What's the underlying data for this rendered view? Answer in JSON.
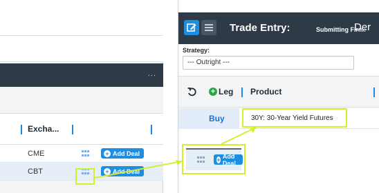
{
  "left_panel": {
    "column_header": "Excha...",
    "rows": [
      {
        "exchange": "CME",
        "add_deal_label": "Add Deal"
      },
      {
        "exchange": "CBT",
        "add_deal_label": "Add Deal"
      }
    ],
    "menu_dots": "..."
  },
  "trade_entry": {
    "title": "Trade Entry:",
    "submitting_firm_label": "Submitting Firm:",
    "submitting_firm_value": "Der",
    "strategy_label": "Strategy:",
    "strategy_value": "--- Outright ---",
    "leg_label": "Leg",
    "product_header": "Product",
    "row": {
      "side": "Buy",
      "product": "30Y: 30-Year Yield Futures"
    }
  },
  "callout": {
    "add_deal_label": "Add Deal",
    "highlight_color": "#d4ee32"
  },
  "colors": {
    "header_bg": "#2f3a47",
    "accent_blue": "#1e8fe0",
    "leg_green": "#27a844"
  },
  "icons": [
    "edit-icon",
    "list-icon",
    "undo-icon",
    "grid-icon",
    "plus-icon",
    "more-icon"
  ]
}
